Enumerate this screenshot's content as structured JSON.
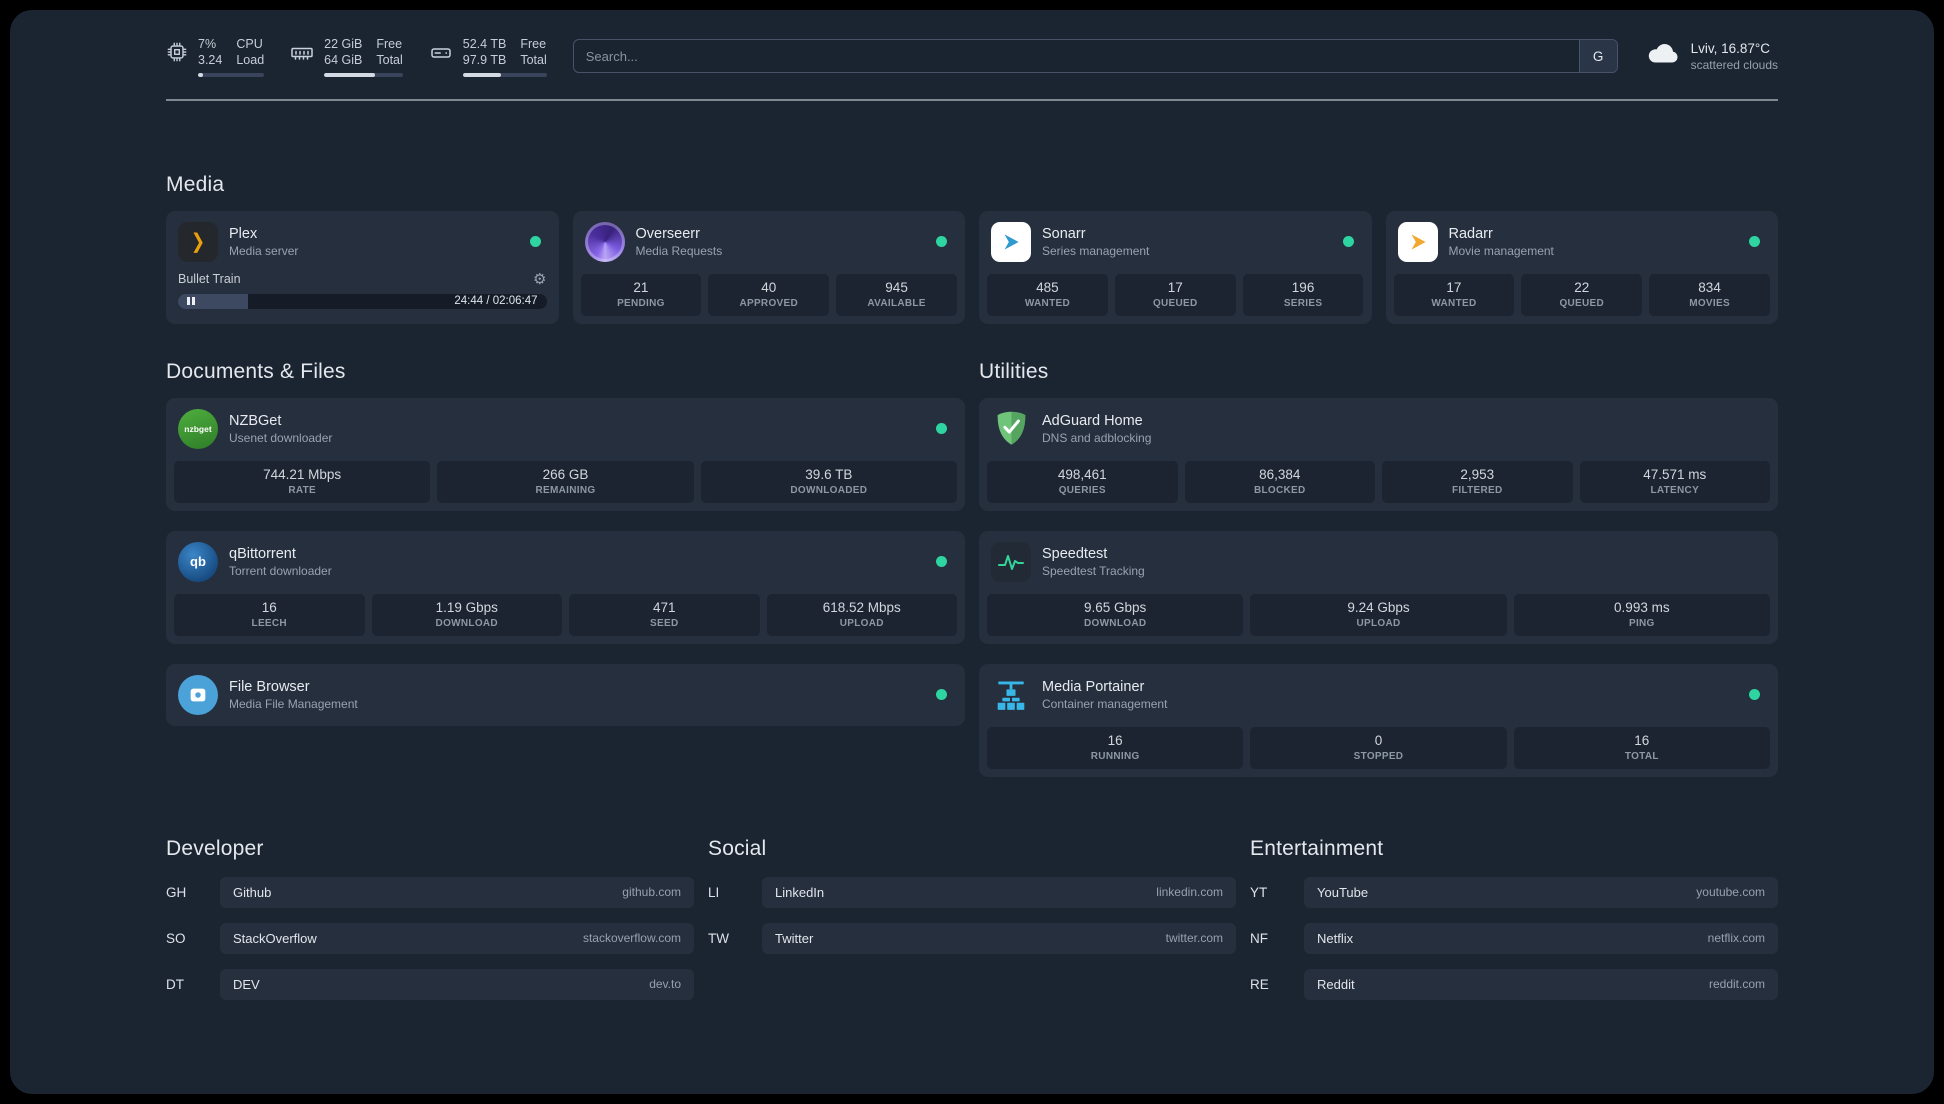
{
  "colors": {
    "background": "#1b2431",
    "card": "#252f3e",
    "stat_block": "#1b2430",
    "status_ok": "#2fd5a0",
    "plex_accent": "#e8a00c"
  },
  "topbar": {
    "cpu": {
      "value_top": "7%",
      "value_bottom": "3.24",
      "label_top": "CPU",
      "label_bottom": "Load",
      "percent": 7
    },
    "memory": {
      "value_top": "22 GiB",
      "value_bottom": "64 GiB",
      "label_top": "Free",
      "label_bottom": "Total",
      "percent": 65
    },
    "disk": {
      "value_top": "52.4 TB",
      "value_bottom": "97.9 TB",
      "label_top": "Free",
      "label_bottom": "Total",
      "percent": 46
    },
    "search": {
      "placeholder": "Search...",
      "provider_label": "G"
    },
    "weather": {
      "location": "Lviv, 16.87°C",
      "condition": "scattered clouds"
    }
  },
  "icons": {
    "plex_glyph": "❯",
    "gear_glyph": "⚙",
    "nzbget_label": "nzbget",
    "qb_label": "qb"
  },
  "media": {
    "title": "Media",
    "plex": {
      "name": "Plex",
      "description": "Media server",
      "now_playing": "Bullet Train",
      "progress_time": "24:44 / 02:06:47",
      "progress_percent": 19
    },
    "overseerr": {
      "name": "Overseerr",
      "description": "Media Requests",
      "stats": [
        {
          "value": "21",
          "label": "PENDING"
        },
        {
          "value": "40",
          "label": "APPROVED"
        },
        {
          "value": "945",
          "label": "AVAILABLE"
        }
      ]
    },
    "sonarr": {
      "name": "Sonarr",
      "description": "Series management",
      "stats": [
        {
          "value": "485",
          "label": "WANTED"
        },
        {
          "value": "17",
          "label": "QUEUED"
        },
        {
          "value": "196",
          "label": "SERIES"
        }
      ]
    },
    "radarr": {
      "name": "Radarr",
      "description": "Movie management",
      "stats": [
        {
          "value": "17",
          "label": "WANTED"
        },
        {
          "value": "22",
          "label": "QUEUED"
        },
        {
          "value": "834",
          "label": "MOVIES"
        }
      ]
    }
  },
  "documents": {
    "title": "Documents & Files",
    "nzbget": {
      "name": "NZBGet",
      "description": "Usenet downloader",
      "stats": [
        {
          "value": "744.21 Mbps",
          "label": "RATE"
        },
        {
          "value": "266 GB",
          "label": "REMAINING"
        },
        {
          "value": "39.6 TB",
          "label": "DOWNLOADED"
        }
      ]
    },
    "qbittorrent": {
      "name": "qBittorrent",
      "description": "Torrent downloader",
      "stats": [
        {
          "value": "16",
          "label": "LEECH"
        },
        {
          "value": "1.19 Gbps",
          "label": "DOWNLOAD"
        },
        {
          "value": "471",
          "label": "SEED"
        },
        {
          "value": "618.52 Mbps",
          "label": "UPLOAD"
        }
      ]
    },
    "filebrowser": {
      "name": "File Browser",
      "description": "Media File Management"
    }
  },
  "utilities": {
    "title": "Utilities",
    "adguard": {
      "name": "AdGuard Home",
      "description": "DNS and adblocking",
      "stats": [
        {
          "value": "498,461",
          "label": "QUERIES"
        },
        {
          "value": "86,384",
          "label": "BLOCKED"
        },
        {
          "value": "2,953",
          "label": "FILTERED"
        },
        {
          "value": "47.571 ms",
          "label": "LATENCY"
        }
      ]
    },
    "speedtest": {
      "name": "Speedtest",
      "description": "Speedtest Tracking",
      "stats": [
        {
          "value": "9.65 Gbps",
          "label": "DOWNLOAD"
        },
        {
          "value": "9.24 Gbps",
          "label": "UPLOAD"
        },
        {
          "value": "0.993 ms",
          "label": "PING"
        }
      ]
    },
    "portainer": {
      "name": "Media Portainer",
      "description": "Container management",
      "stats": [
        {
          "value": "16",
          "label": "RUNNING"
        },
        {
          "value": "0",
          "label": "STOPPED"
        },
        {
          "value": "16",
          "label": "TOTAL"
        }
      ]
    }
  },
  "bookmarks": {
    "developer": {
      "title": "Developer",
      "items": [
        {
          "abbr": "GH",
          "name": "Github",
          "url": "github.com"
        },
        {
          "abbr": "SO",
          "name": "StackOverflow",
          "url": "stackoverflow.com"
        },
        {
          "abbr": "DT",
          "name": "DEV",
          "url": "dev.to"
        }
      ]
    },
    "social": {
      "title": "Social",
      "items": [
        {
          "abbr": "LI",
          "name": "LinkedIn",
          "url": "linkedin.com"
        },
        {
          "abbr": "TW",
          "name": "Twitter",
          "url": "twitter.com"
        }
      ]
    },
    "entertainment": {
      "title": "Entertainment",
      "items": [
        {
          "abbr": "YT",
          "name": "YouTube",
          "url": "youtube.com"
        },
        {
          "abbr": "NF",
          "name": "Netflix",
          "url": "netflix.com"
        },
        {
          "abbr": "RE",
          "name": "Reddit",
          "url": "reddit.com"
        }
      ]
    }
  }
}
